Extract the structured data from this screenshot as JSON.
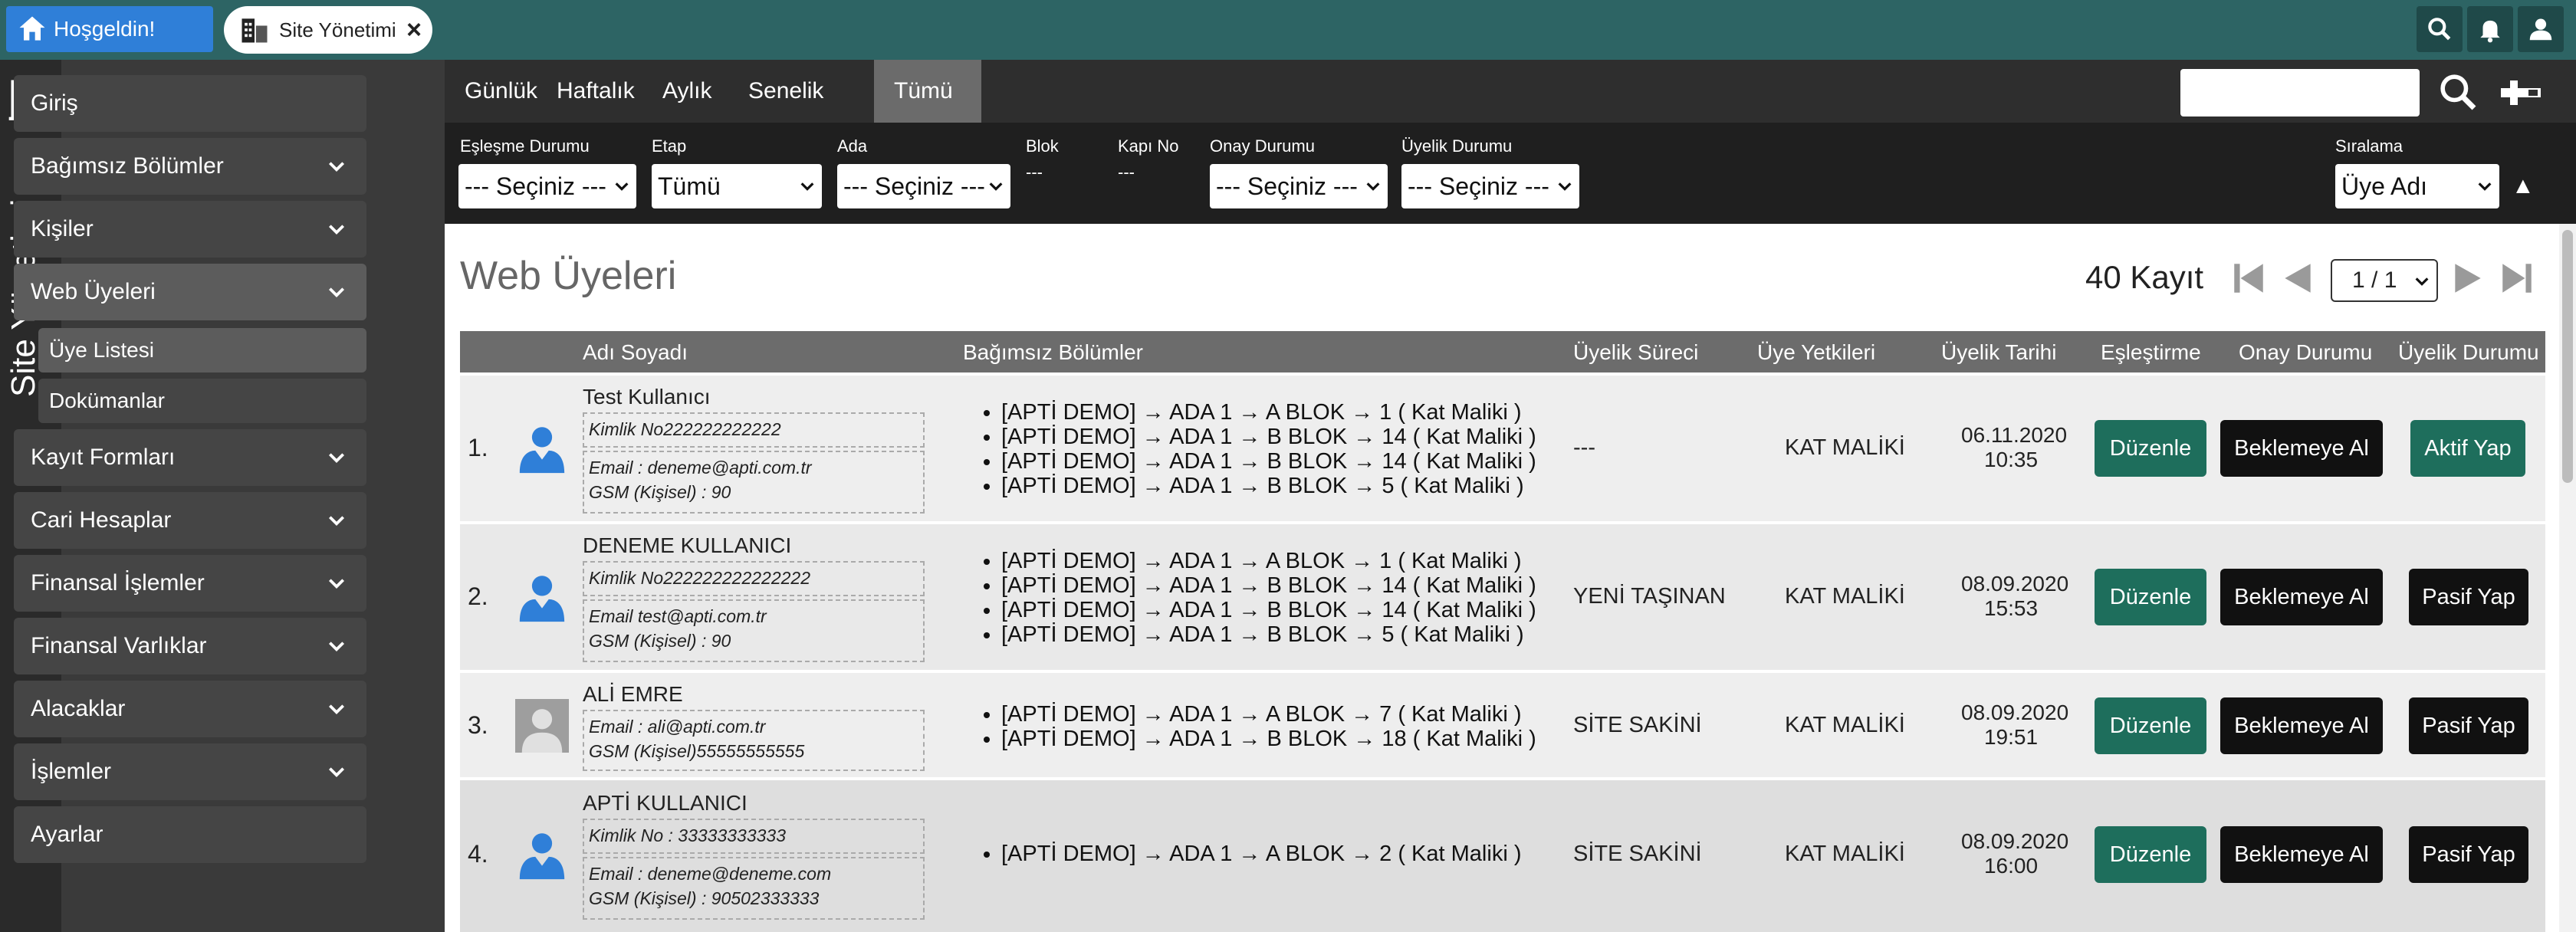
{
  "tabs": {
    "home_label": "Hoşgeldin!",
    "site_label": "Site Yönetimi"
  },
  "app": {
    "vertical_title": "Site Yönetimi"
  },
  "sidebar": {
    "items": [
      {
        "label": "Giriş"
      },
      {
        "label": "Bağımsız Bölümler"
      },
      {
        "label": "Kişiler"
      },
      {
        "label": "Web Üyeleri"
      },
      {
        "label": "Kayıt Formları"
      },
      {
        "label": "Cari Hesaplar"
      },
      {
        "label": "Finansal İşlemler"
      },
      {
        "label": "Finansal Varlıklar"
      },
      {
        "label": "Alacaklar"
      },
      {
        "label": "İşlemler"
      },
      {
        "label": "Ayarlar"
      }
    ],
    "subitems": [
      {
        "label": "Üye Listesi"
      },
      {
        "label": "Dokümanlar"
      }
    ]
  },
  "period_tabs": [
    "Günlük",
    "Haftalık",
    "Aylık",
    "Senelik",
    "Tümü"
  ],
  "filters": {
    "eslesme": {
      "label": "Eşleşme Durumu",
      "value": "--- Seçiniz ---"
    },
    "etap": {
      "label": "Etap",
      "value": "Tümü"
    },
    "ada": {
      "label": "Ada",
      "value": "--- Seçiniz ---"
    },
    "blok": {
      "label": "Blok",
      "value": "---"
    },
    "kapi": {
      "label": "Kapı No",
      "value": "---"
    },
    "onay": {
      "label": "Onay Durumu",
      "value": "--- Seçiniz ---"
    },
    "uyelik": {
      "label": "Üyelik Durumu",
      "value": "--- Seçiniz ---"
    },
    "siralama": {
      "label": "Sıralama",
      "value": "Üye Adı",
      "arrow": "▲"
    }
  },
  "main": {
    "title": "Web Üyeleri",
    "record_count": "40 Kayıt",
    "page_select": "1 / 1"
  },
  "table": {
    "headers": {
      "name": "Adı Soyadı",
      "units": "Bağımsız Bölümler",
      "process": "Üyelik Süreci",
      "roles": "Üye Yetkileri",
      "date": "Üyelik Tarihi",
      "match": "Eşleştirme",
      "approval": "Onay Durumu",
      "membership": "Üyelik Durumu"
    },
    "rows": [
      {
        "num": "1.",
        "name": "Test Kullanıcı",
        "kimlik": "Kimlik No222222222222",
        "email": "Email : deneme@apti.com.tr",
        "gsm": "GSM (Kişisel) : 90",
        "units": [
          "[APTİ DEMO] → ADA 1 → A BLOK → 1 ( Kat Maliki )",
          "[APTİ DEMO] → ADA 1 → B BLOK → 14 ( Kat Maliki )",
          "[APTİ DEMO] → ADA 1 → B BLOK → 14 ( Kat Maliki )",
          "[APTİ DEMO] → ADA 1 → B BLOK → 5 ( Kat Maliki )"
        ],
        "process": "---",
        "role": "KAT MALİKİ",
        "date": "06.11.2020",
        "time": "10:35",
        "match_btn": "Düzenle",
        "approval_btn": "Beklemeye Al",
        "status_btn": "Aktif Yap"
      },
      {
        "num": "2.",
        "name": "DENEME KULLANICI",
        "kimlik": "Kimlik No222222222222222",
        "email": "Email test@apti.com.tr",
        "gsm": "GSM (Kişisel) : 90",
        "units": [
          "[APTİ DEMO] → ADA 1 → A BLOK → 1 ( Kat Maliki )",
          "[APTİ DEMO] → ADA 1 → B BLOK → 14 ( Kat Maliki )",
          "[APTİ DEMO] → ADA 1 → B BLOK → 14 ( Kat Maliki )",
          "[APTİ DEMO] → ADA 1 → B BLOK → 5 ( Kat Maliki )"
        ],
        "process": "YENİ TAŞINAN",
        "role": "KAT MALİKİ",
        "date": "08.09.2020",
        "time": "15:53",
        "match_btn": "Düzenle",
        "approval_btn": "Beklemeye Al",
        "status_btn": "Pasif Yap"
      },
      {
        "num": "3.",
        "name": "ALİ EMRE",
        "email": "Email : ali@apti.com.tr",
        "gsm": "GSM (Kişisel)55555555555",
        "units": [
          "[APTİ DEMO] → ADA 1 → A BLOK → 7 ( Kat Maliki )",
          "[APTİ DEMO] → ADA 1 → B BLOK → 18 ( Kat Maliki )"
        ],
        "process": "SİTE SAKİNİ",
        "role": "KAT MALİKİ",
        "date": "08.09.2020",
        "time": "19:51",
        "match_btn": "Düzenle",
        "approval_btn": "Beklemeye Al",
        "status_btn": "Pasif Yap"
      },
      {
        "num": "4.",
        "name": "APTİ KULLANICI",
        "kimlik": "Kimlik No : 33333333333",
        "email": "Email : deneme@deneme.com",
        "gsm": "GSM (Kişisel) : 90502333333",
        "units": [
          "[APTİ DEMO] → ADA 1 → A BLOK → 2 ( Kat Maliki )"
        ],
        "process": "SİTE SAKİNİ",
        "role": "KAT MALİKİ",
        "date": "08.09.2020",
        "time": "16:00",
        "match_btn": "Düzenle",
        "approval_btn": "Beklemeye Al",
        "status_btn": "Pasif Yap"
      }
    ]
  },
  "colors": {
    "topbar": "#2d6464",
    "home_tab": "#2f7fd8",
    "button_green": "#1e6e5c",
    "button_black": "#111111",
    "sidebar": "#3a3a3a"
  },
  "icons": [
    "home-icon",
    "building-icon",
    "close-icon",
    "search-icon",
    "bell-icon",
    "user-icon",
    "chevron-down-icon",
    "filter-icon",
    "first-page-icon",
    "prev-page-icon",
    "next-page-icon",
    "last-page-icon",
    "avatar-icon"
  ]
}
